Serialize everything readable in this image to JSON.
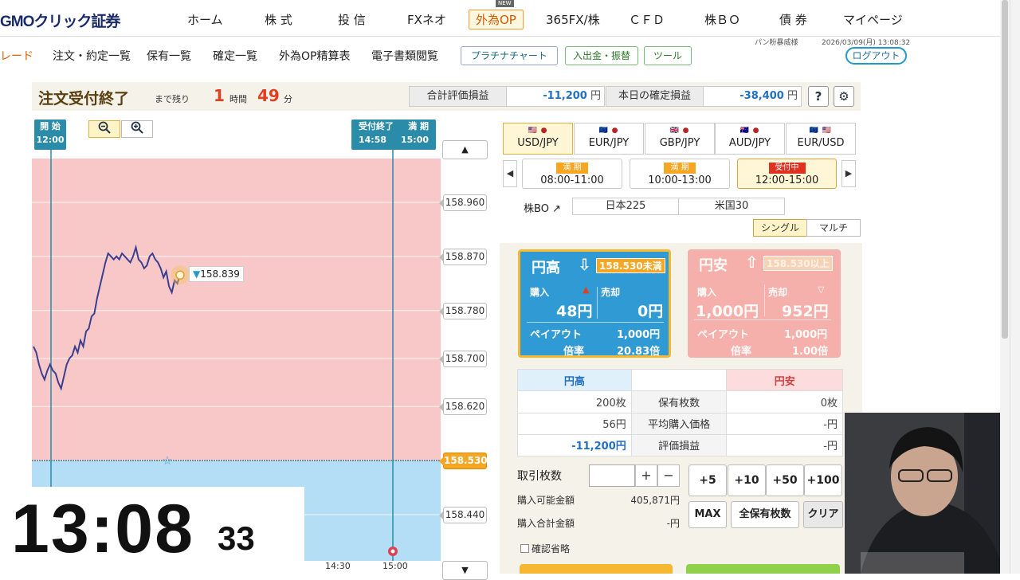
{
  "brand": {
    "logo": "GMOクリック証券",
    "new_badge": "NEW"
  },
  "nav": {
    "items": [
      "ホーム",
      "株 式",
      "投 信",
      "FXネオ",
      "外為OP",
      "365FX/株",
      "ＣＦＤ",
      "株ＢＯ",
      "債 券",
      "マイページ"
    ],
    "active": "外為OP"
  },
  "subnav": {
    "items": [
      "レード",
      "注文・約定一覧",
      "保有一覧",
      "確定一覧",
      "外為OP精算表",
      "電子書類閲覧"
    ],
    "buttons": [
      "プラチナチャート",
      "入出金・振替",
      "ツール"
    ],
    "logout": "ログアウト",
    "user": "パン粉暴威様",
    "datetime": "2026/03/09(月) 13:08:32"
  },
  "status": {
    "title": "注文受付終了",
    "remaining_label": "まで残り",
    "hours": "1",
    "hours_unit": "時間",
    "minutes": "49",
    "minutes_unit": "分",
    "unrealized_label": "合計評価損益",
    "unrealized_value": "-11,200",
    "unit": "円",
    "realized_label": "本日の確定損益",
    "realized_value": "-38,400",
    "help": "?",
    "settings": "⚙"
  },
  "chart": {
    "start_label": "開 始",
    "start_time": "12:00",
    "end_label": "受付終了",
    "end_time": "14:58",
    "expiry_label": "満 期",
    "expiry_time": "15:00",
    "zoom_out": "−",
    "zoom_in": "+",
    "current_price": "158.839",
    "strike_price": "158.530",
    "x_ticks": [
      "14:30",
      "15:00"
    ]
  },
  "chart_data": {
    "type": "line",
    "yaxis_ticks": [
      "158.960",
      "158.870",
      "158.780",
      "158.700",
      "158.620",
      "158.530",
      "158.440"
    ],
    "y_ticks": [
      158.96,
      158.87,
      158.78,
      158.7,
      158.62,
      158.53,
      158.44
    ],
    "strike": 158.53,
    "series": [
      {
        "values": [
          158.72,
          158.71,
          158.69,
          158.675,
          158.665,
          158.68,
          158.69,
          158.68,
          158.675,
          158.66,
          158.65,
          158.67,
          158.69,
          158.7,
          158.705,
          158.72,
          158.71,
          158.73,
          158.72,
          158.745,
          158.75,
          158.77,
          158.775,
          158.8,
          158.82,
          158.84,
          158.86,
          158.875,
          158.87,
          158.865,
          158.87,
          158.865,
          158.875,
          158.87,
          158.865,
          158.86,
          158.87,
          158.885,
          158.865,
          158.86,
          158.85,
          158.855,
          158.87,
          158.875,
          158.865,
          158.86,
          158.85,
          158.835,
          158.845,
          158.82,
          158.81,
          158.83,
          158.825,
          158.839
        ]
      }
    ]
  },
  "clock": {
    "hm": "13:08",
    "sec": "33"
  },
  "currencies": [
    {
      "flags": "🇺🇸 ●",
      "name": "USD/JPY",
      "selected": true
    },
    {
      "flags": "🇪🇺 ●",
      "name": "EUR/JPY",
      "selected": false
    },
    {
      "flags": "🇬🇧 ●",
      "name": "GBP/JPY",
      "selected": false
    },
    {
      "flags": "🇦🇺 ●",
      "name": "AUD/JPY",
      "selected": false
    },
    {
      "flags": "🇪🇺 🇺🇸",
      "name": "EUR/USD",
      "selected": false
    }
  ],
  "periods": [
    {
      "badge": "満 期",
      "time": "08:00-11:00"
    },
    {
      "badge": "満 期",
      "time": "10:00-13:00"
    },
    {
      "badge": "受付中",
      "time": "12:00-15:00"
    }
  ],
  "kabu": {
    "label": "株BO ↗",
    "items": [
      "日本225",
      "米国30"
    ]
  },
  "modes": [
    "シングル",
    "マルチ"
  ],
  "up_card": {
    "title": "円高",
    "strike_text": "158.530未満",
    "buy_label": "購入",
    "sell_label": "売却",
    "buy_price": "48円",
    "sell_price": "0円",
    "payout_label": "ペイアウト",
    "payout": "1,000円",
    "rate_label": "倍率",
    "rate": "20.83倍"
  },
  "down_card": {
    "title": "円安",
    "strike_text": "158.530以上",
    "buy_label": "購入",
    "sell_label": "売却",
    "buy_price": "1,000円",
    "sell_price": "952円",
    "payout_label": "ペイアウト",
    "payout": "1,000円",
    "rate_label": "倍率",
    "rate": "1.00倍"
  },
  "holdings": {
    "up_label": "円高",
    "down_label": "円安",
    "rows": [
      {
        "up": "200枚",
        "label": "保有枚数",
        "down": "0枚"
      },
      {
        "up": "56円",
        "label": "平均購入価格",
        "down": "-円"
      },
      {
        "up": "-11,200円",
        "label": "評価損益",
        "down": "-円"
      }
    ]
  },
  "order": {
    "lot_label": "取引枚数",
    "plus": "+",
    "minus": "−",
    "quick": [
      "+5",
      "+10",
      "+50",
      "+100"
    ],
    "quick2": [
      "MAX",
      "全保有枚数",
      "クリア"
    ],
    "avail_label": "購入可能金額",
    "avail_value": "405,871円",
    "total_label": "購入合計金額",
    "total_value": "-円",
    "confirm_skip": "確認省略"
  },
  "colors": {
    "up_bg": "#f8c8c8",
    "down_bg": "#b3def5",
    "accent": "#f5a623",
    "line": "#3b3f8f"
  }
}
